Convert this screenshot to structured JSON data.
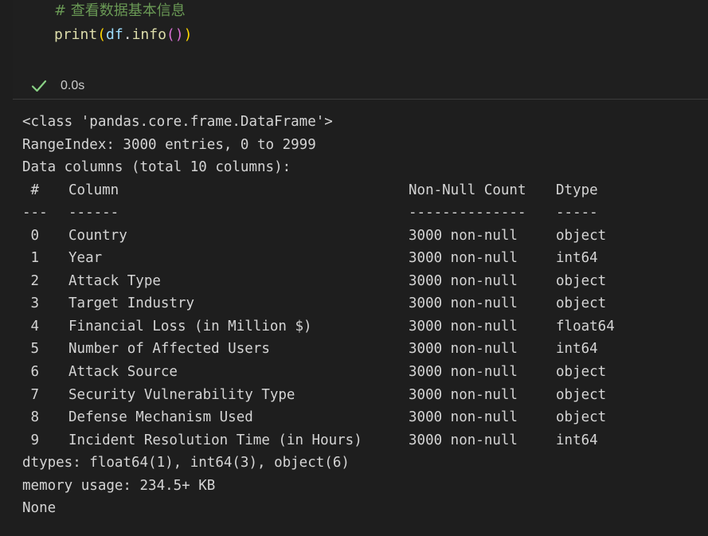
{
  "cell": {
    "comment": "# 查看数据基本信息",
    "code": {
      "func": "print",
      "open1": "(",
      "var": "df",
      "dot": ".",
      "method": "info",
      "open2": "(",
      "close2": ")",
      "close1": ")"
    },
    "status": {
      "icon": "check-icon",
      "time": "0.0s",
      "color": "#89d185"
    }
  },
  "output": {
    "header_lines": [
      "<class 'pandas.core.frame.DataFrame'>",
      "RangeIndex: 3000 entries, 0 to 2999",
      "Data columns (total 10 columns):"
    ],
    "table_header": {
      "idx": " #",
      "name": "Column",
      "count": "Non-Null Count",
      "dtype": "Dtype"
    },
    "table_rule": {
      "idx": "---",
      "name": "------",
      "count": "--------------",
      "dtype": "-----"
    },
    "rows": [
      {
        "idx": " 0",
        "name": "Country",
        "count": "3000 non-null",
        "dtype": "object"
      },
      {
        "idx": " 1",
        "name": "Year",
        "count": "3000 non-null",
        "dtype": "int64"
      },
      {
        "idx": " 2",
        "name": "Attack Type",
        "count": "3000 non-null",
        "dtype": "object"
      },
      {
        "idx": " 3",
        "name": "Target Industry",
        "count": "3000 non-null",
        "dtype": "object"
      },
      {
        "idx": " 4",
        "name": "Financial Loss (in Million $)",
        "count": "3000 non-null",
        "dtype": "float64"
      },
      {
        "idx": " 5",
        "name": "Number of Affected Users",
        "count": "3000 non-null",
        "dtype": "int64"
      },
      {
        "idx": " 6",
        "name": "Attack Source",
        "count": "3000 non-null",
        "dtype": "object"
      },
      {
        "idx": " 7",
        "name": "Security Vulnerability Type",
        "count": "3000 non-null",
        "dtype": "object"
      },
      {
        "idx": " 8",
        "name": "Defense Mechanism Used",
        "count": "3000 non-null",
        "dtype": "object"
      },
      {
        "idx": " 9",
        "name": "Incident Resolution Time (in Hours)",
        "count": "3000 non-null",
        "dtype": "int64"
      }
    ],
    "footer_lines": [
      "dtypes: float64(1), int64(3), object(6)",
      "memory usage: 234.5+ KB",
      "None"
    ]
  }
}
